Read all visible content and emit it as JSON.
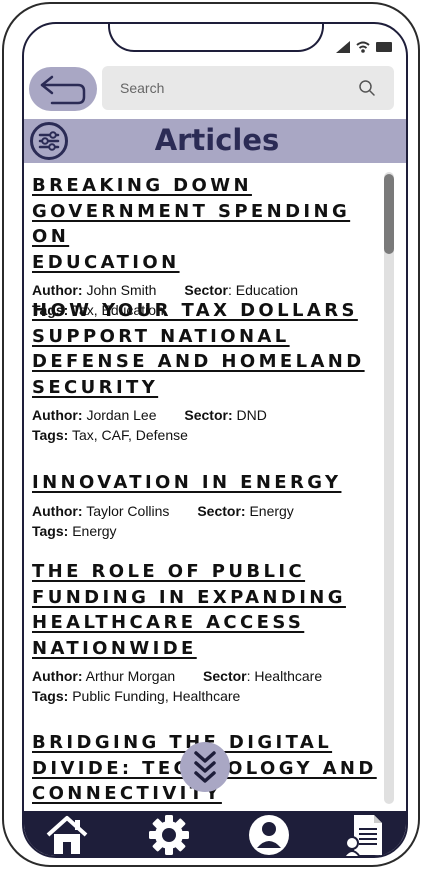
{
  "search": {
    "placeholder": "Search"
  },
  "header": {
    "title": "Articles"
  },
  "articles": [
    {
      "title_lines": [
        "BREAKING DOWN",
        "GOVERNMENT SPENDING ON",
        "EDUCATION"
      ],
      "author_label": "Author:",
      "author": "John Smith",
      "sector_label": "Sector",
      "sector": ": Education",
      "tags_label": "Tags:",
      "tags": "Tax, Education"
    },
    {
      "title_lines": [
        "HOW YOUR TAX DOLLARS",
        "SUPPORT NATIONAL",
        "DEFENSE AND HOMELAND",
        "SECURITY"
      ],
      "author_label": "Author:",
      "author": "Jordan Lee",
      "sector_label": "Sector:",
      "sector": " DND",
      "tags_label": "Tags:",
      "tags": "Tax, CAF, Defense"
    },
    {
      "title_lines": [
        "INNOVATION IN ENERGY"
      ],
      "author_label": "Author:",
      "author": "Taylor Collins",
      "sector_label": "Sector:",
      "sector": " Energy",
      "tags_label": "Tags:",
      "tags": "Energy"
    },
    {
      "title_lines": [
        "THE ROLE OF PUBLIC",
        "FUNDING IN EXPANDING",
        "HEALTHCARE ACCESS",
        "NATIONWIDE"
      ],
      "author_label": "Author:",
      "author": "Arthur Morgan",
      "sector_label": "Sector",
      "sector": ": Healthcare",
      "tags_label": "Tags:",
      "tags": "Public Funding, Healthcare"
    },
    {
      "title_lines": [
        "BRIDGING THE DIGITAL",
        "DIVIDE: TECHNOLOGY AND",
        "CONNECTIVITY"
      ]
    }
  ],
  "icons": {
    "back": "back-arrow-icon",
    "search": "search-icon",
    "filter": "filter-sliders-icon",
    "scroll_down": "chevrons-down-icon",
    "home": "home-icon",
    "settings": "gear-icon",
    "profile": "user-icon",
    "documents": "document-icon"
  },
  "colors": {
    "accent": "#a9a7c4",
    "navy": "#1e1e3a",
    "title": "#2b2b55"
  }
}
